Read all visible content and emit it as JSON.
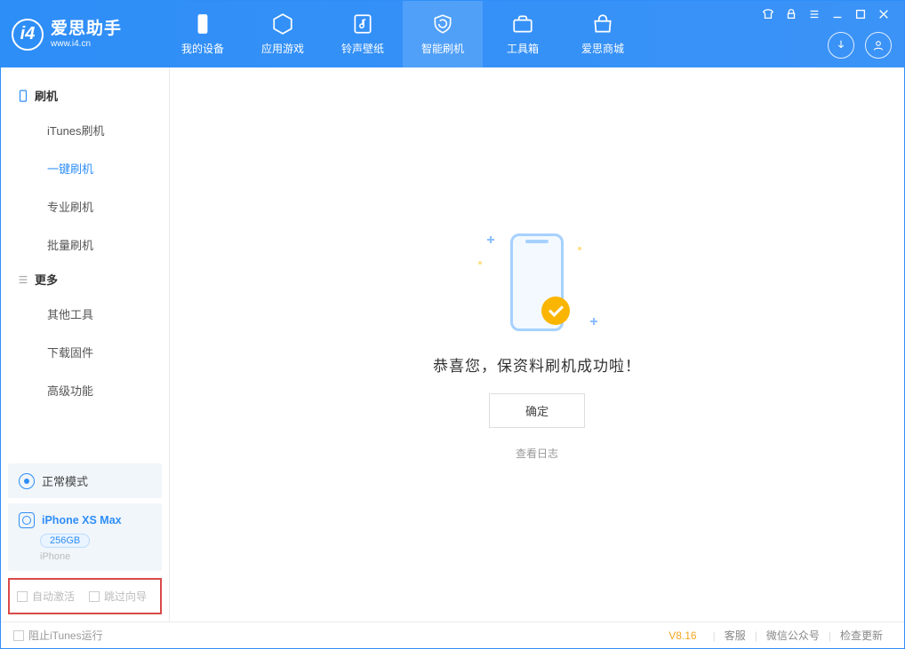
{
  "app": {
    "title": "爱思助手",
    "url": "www.i4.cn"
  },
  "nav_tabs": [
    {
      "label": "我的设备"
    },
    {
      "label": "应用游戏"
    },
    {
      "label": "铃声壁纸"
    },
    {
      "label": "智能刷机"
    },
    {
      "label": "工具箱"
    },
    {
      "label": "爱思商城"
    }
  ],
  "sidebar": {
    "section1": {
      "title": "刷机"
    },
    "items1": [
      {
        "label": "iTunes刷机"
      },
      {
        "label": "一键刷机"
      },
      {
        "label": "专业刷机"
      },
      {
        "label": "批量刷机"
      }
    ],
    "section2": {
      "title": "更多"
    },
    "items2": [
      {
        "label": "其他工具"
      },
      {
        "label": "下载固件"
      },
      {
        "label": "高级功能"
      }
    ]
  },
  "status": {
    "mode_label": "正常模式"
  },
  "device": {
    "name": "iPhone XS Max",
    "storage": "256GB",
    "type": "iPhone"
  },
  "bottom_checks": {
    "auto_activate": "自动激活",
    "skip_wizard": "跳过向导"
  },
  "main": {
    "message": "恭喜您，保资料刷机成功啦！",
    "ok_label": "确定",
    "view_log": "查看日志"
  },
  "footer": {
    "block_itunes": "阻止iTunes运行",
    "version": "V8.16",
    "support": "客服",
    "wechat": "微信公众号",
    "check_update": "检查更新"
  }
}
